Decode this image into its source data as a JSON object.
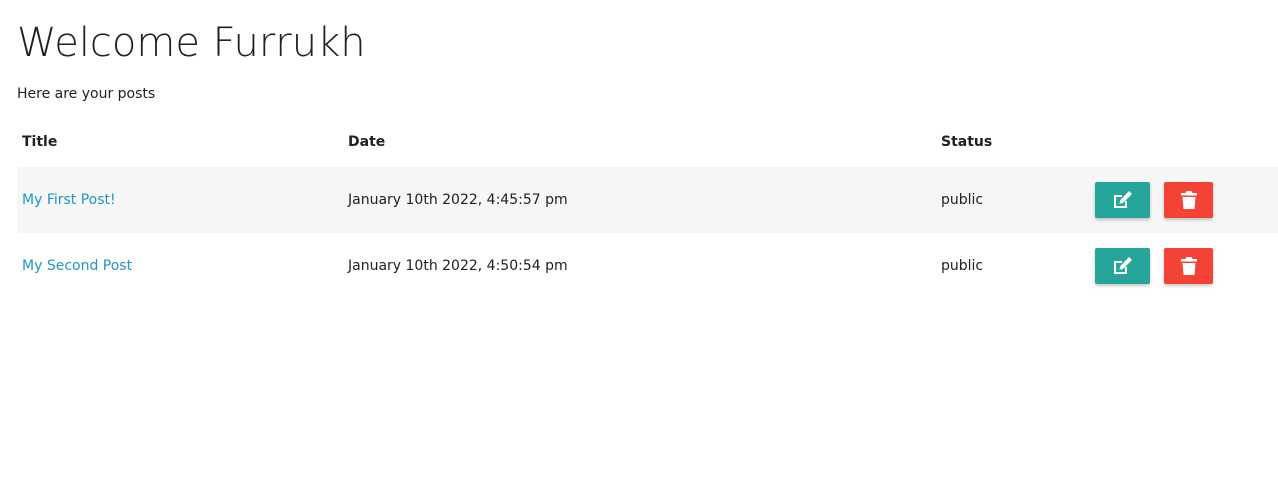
{
  "header": {
    "welcome": "Welcome Furrukh",
    "subtitle": "Here are your posts"
  },
  "table": {
    "columns": {
      "title": "Title",
      "date": "Date",
      "status": "Status"
    },
    "rows": [
      {
        "title": "My First Post!",
        "date": "January 10th 2022, 4:45:57 pm",
        "status": "public"
      },
      {
        "title": "My Second Post",
        "date": "January 10th 2022, 4:50:54 pm",
        "status": "public"
      }
    ]
  },
  "icons": {
    "edit": "edit-icon",
    "delete": "trash-icon"
  },
  "colors": {
    "link": "#2196c3",
    "edit_button": "#26a69a",
    "delete_button": "#f44336",
    "row_stripe": "#f6f6f6"
  }
}
